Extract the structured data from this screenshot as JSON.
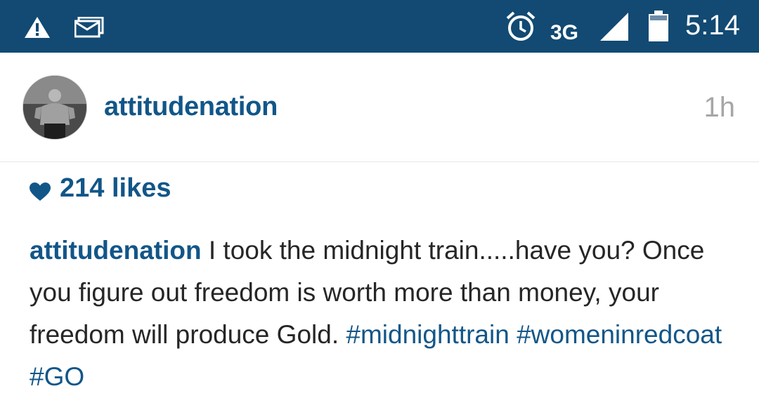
{
  "status_bar": {
    "background": "#124a73",
    "icons": [
      "warning-icon",
      "message-icon",
      "alarm-icon",
      "signal-icon",
      "battery-icon"
    ],
    "network": "3G",
    "time": "5:14"
  },
  "post": {
    "avatar_icon": "avatar",
    "username": "attitudenation",
    "time_ago": "1h",
    "likes": "214 likes",
    "caption": {
      "username": "attitudenation",
      "text": " I took the midnight train.....have you? Once you figure out freedom is worth more than money, your freedom will produce Gold. ",
      "hashtags": [
        "#midnighttrain",
        "#womeninredcoat",
        "#GO"
      ]
    }
  },
  "colors": {
    "link_blue": "#125688",
    "text": "#262626",
    "muted": "#a6a6a6"
  }
}
